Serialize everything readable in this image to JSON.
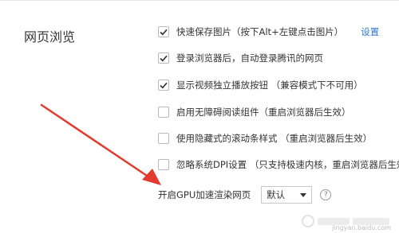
{
  "section": {
    "title": "网页浏览"
  },
  "options": [
    {
      "label": "快速保存图片（按下Alt+左键点击图片）",
      "checked": true,
      "link": "设置"
    },
    {
      "label": "登录浏览器后，自动登录腾讯的网页",
      "checked": true
    },
    {
      "label": "显示视频独立播放按钮 （兼容模式下不可用）",
      "checked": true
    },
    {
      "label": "启用无障碍阅读组件（重启浏览器后生效）",
      "checked": false
    },
    {
      "label": "使用隐藏式的滚动条样式 （重启浏览器后生效）",
      "checked": false
    },
    {
      "label": "忽略系统DPI设置 （只支持极速内核，重启浏览器后生效）",
      "checked": false
    }
  ],
  "gpu": {
    "label": "开启GPU加速渲染网页",
    "selected": "默认",
    "help": "?"
  },
  "annotation": {
    "arrow_color": "#e23b2e"
  },
  "colors": {
    "link": "#2f78d3",
    "text": "#333333"
  },
  "watermark": {
    "text": "jingyan.baidu.com"
  }
}
